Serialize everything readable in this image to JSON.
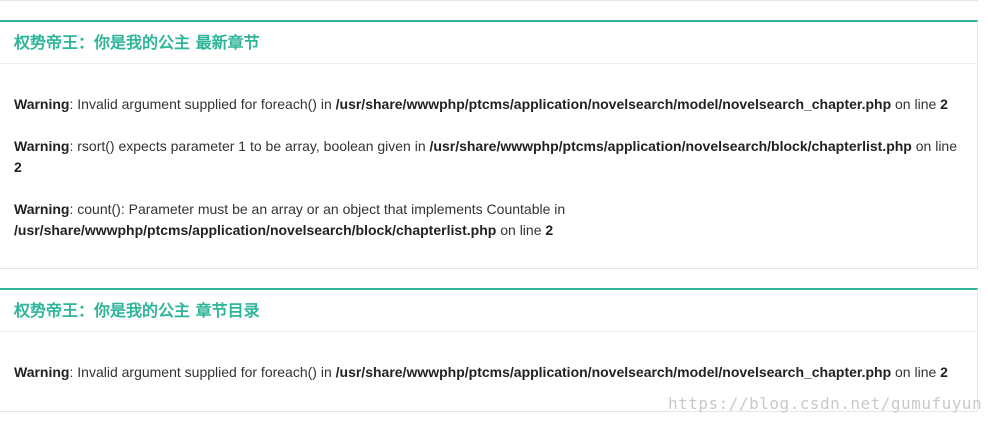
{
  "sections": [
    {
      "title": "权势帝王：你是我的公主 最新章节",
      "warnings": [
        {
          "label": "Warning",
          "message": ": Invalid argument supplied for foreach() in ",
          "path": "/usr/share/wwwphp/ptcms/application/novelsearch/model/novelsearch_chapter.php",
          "line_text": " on line ",
          "line": "2"
        },
        {
          "label": "Warning",
          "message": ": rsort() expects parameter 1 to be array, boolean given in ",
          "path": "/usr/share/wwwphp/ptcms/application/novelsearch/block/chapterlist.php",
          "line_text": " on line ",
          "line": "2"
        },
        {
          "label": "Warning",
          "message": ": count(): Parameter must be an array or an object that implements Countable in ",
          "path": "/usr/share/wwwphp/ptcms/application/novelsearch/block/chapterlist.php",
          "line_text": " on line ",
          "line": "2"
        }
      ]
    },
    {
      "title": "权势帝王：你是我的公主 章节目录",
      "warnings": [
        {
          "label": "Warning",
          "message": ": Invalid argument supplied for foreach() in ",
          "path": "/usr/share/wwwphp/ptcms/application/novelsearch/model/novelsearch_chapter.php",
          "line_text": " on line ",
          "line": "2"
        }
      ]
    }
  ],
  "watermark": "https://blog.csdn.net/gumufuyun",
  "colors": {
    "accent": "#2fb59a",
    "text": "#333333",
    "border": "#e6e6e6"
  }
}
